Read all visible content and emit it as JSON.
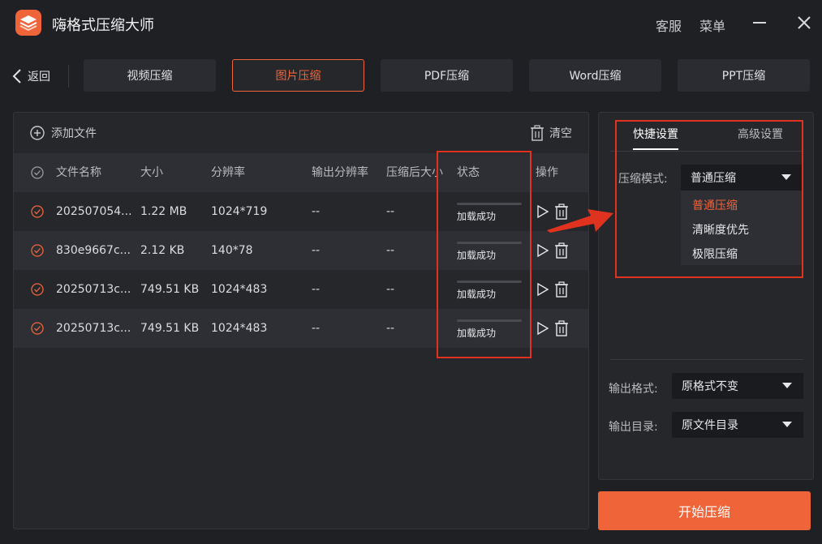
{
  "app": {
    "title": "嗨格式压缩大师"
  },
  "titlebar": {
    "service": "客服",
    "menu": "菜单"
  },
  "nav": {
    "back": "返回",
    "tabs": [
      {
        "label": "视频压缩",
        "active": false
      },
      {
        "label": "图片压缩",
        "active": true
      },
      {
        "label": "PDF压缩",
        "active": false
      },
      {
        "label": "Word压缩",
        "active": false
      },
      {
        "label": "PPT压缩",
        "active": false
      }
    ]
  },
  "file_panel": {
    "add_file": "添加文件",
    "clear": "清空",
    "columns": [
      "文件名称",
      "大小",
      "分辨率",
      "输出分辨率",
      "压缩后大小",
      "状态",
      "操作"
    ],
    "rows": [
      {
        "name": "202507054...",
        "size": "1.22 MB",
        "resolution": "1024*719",
        "output_resolution": "--",
        "compressed_size": "--",
        "status": "加载成功"
      },
      {
        "name": "830e9667c...",
        "size": "2.12 KB",
        "resolution": "140*78",
        "output_resolution": "--",
        "compressed_size": "--",
        "status": "加载成功"
      },
      {
        "name": "20250713c...",
        "size": "749.51 KB",
        "resolution": "1024*483",
        "output_resolution": "--",
        "compressed_size": "--",
        "status": "加载成功"
      },
      {
        "name": "20250713c...",
        "size": "749.51 KB",
        "resolution": "1024*483",
        "output_resolution": "--",
        "compressed_size": "--",
        "status": "加载成功"
      }
    ]
  },
  "settings": {
    "tabs": {
      "quick": "快捷设置",
      "advanced": "高级设置"
    },
    "mode_label": "压缩模式:",
    "mode_value": "普通压缩",
    "mode_options": [
      {
        "label": "普通压缩",
        "selected": true
      },
      {
        "label": "清晰度优先",
        "selected": false
      },
      {
        "label": "极限压缩",
        "selected": false
      }
    ],
    "format_label": "输出格式:",
    "format_value": "原格式不变",
    "dir_label": "输出目录:",
    "dir_value": "原文件目录"
  },
  "start_button": "开始压缩",
  "colors": {
    "accent": "#f0643a",
    "annotation": "#e0331f",
    "background": "#1f2024",
    "panel": "#26272b"
  },
  "icons": [
    "app-logo-icon",
    "close-icon",
    "back-arrow-icon",
    "add-circle-icon",
    "trash-icon",
    "check-circle-icon",
    "play-icon",
    "caret-down-icon",
    "annotation-arrow-icon"
  ]
}
